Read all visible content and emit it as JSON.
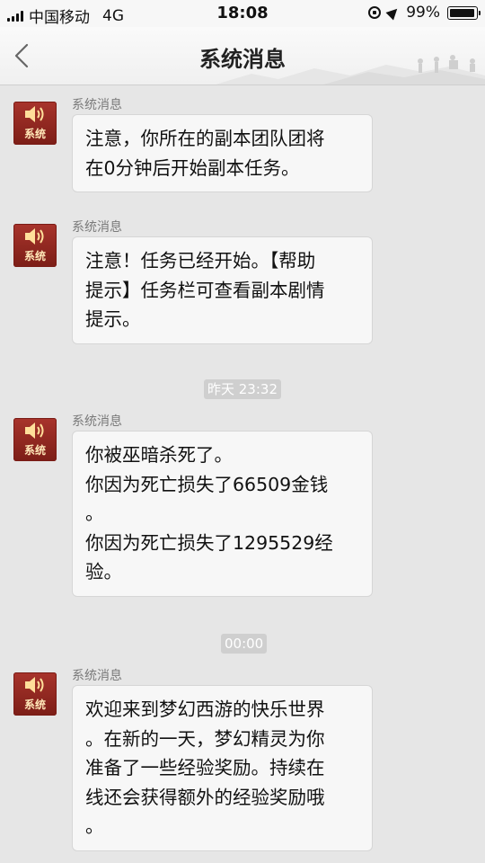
{
  "status_bar": {
    "carrier": "中国移动",
    "network": "4G",
    "time": "18:08",
    "battery_text": "99%",
    "battery_level": 0.99
  },
  "nav": {
    "title": "系统消息",
    "back_icon": "chevron-left-icon"
  },
  "avatar_label": "系统",
  "messages": [
    {
      "sender": "系统消息",
      "lines": [
        "注意，你所在的副本团队团将",
        "在0分钟后开始副本任务。"
      ]
    },
    {
      "sender": "系统消息",
      "lines": [
        "注意！任务已经开始。【帮助",
        "提示】任务栏可查看副本剧情",
        "提示。"
      ]
    },
    {
      "sender": "系统消息",
      "lines": [
        "你被巫暗杀死了。",
        "你因为死亡损失了66509金钱",
        "。",
        "你因为死亡损失了1295529经",
        "验。"
      ]
    },
    {
      "sender": "系统消息",
      "lines": [
        "欢迎来到梦幻西游的快乐世界",
        "。在新的一天，梦幻精灵为你",
        "准备了一些经验奖励。持续在",
        "线还会获得额外的经验奖励哦",
        "。"
      ]
    }
  ],
  "timestamps": [
    "昨天 23:32",
    "00:00"
  ],
  "colors": {
    "avatar_red": "#8e2720",
    "background": "#e6e6e6",
    "bubble": "#f7f7f7"
  }
}
